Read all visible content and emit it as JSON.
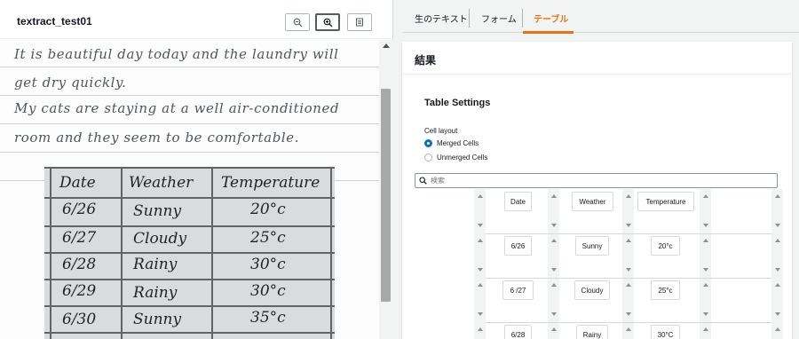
{
  "document": {
    "title": "textract_test01",
    "handwriting": [
      "It is beautiful day today and the laundry will",
      "get dry quickly.",
      "My cats are staying at a well air-conditioned",
      "room and they seem to be comfortable."
    ],
    "photo_table": {
      "headers": [
        "Date",
        "Weather",
        "Temperature"
      ],
      "rows": [
        [
          "6/26",
          "Sunny",
          "20°c"
        ],
        [
          "6/27",
          "Cloudy",
          "25°c"
        ],
        [
          "6/28",
          "Rainy",
          "30°c"
        ],
        [
          "6/29",
          "Rainy",
          "30°c"
        ],
        [
          "6/30",
          "Sunny",
          "35°c"
        ]
      ]
    }
  },
  "tabs": [
    {
      "label": "生のテキスト",
      "active": false
    },
    {
      "label": "フォーム",
      "active": false
    },
    {
      "label": "テーブル",
      "active": true
    }
  ],
  "results": {
    "title": "結果",
    "settings_title": "Table Settings",
    "cell_layout_label": "Cell layout",
    "options": [
      {
        "label": "Merged Cells",
        "selected": true
      },
      {
        "label": "Unmerged Cells",
        "selected": false
      }
    ],
    "search_placeholder": "検索",
    "table": [
      [
        "Date",
        "Weather",
        "Temperature"
      ],
      [
        "6/26",
        "Sunny",
        "20°c"
      ],
      [
        "6 /27",
        "Cloudy",
        "25°c"
      ],
      [
        "6/28",
        "Rainy",
        "30°C"
      ]
    ]
  },
  "colors": {
    "accent": "#ec7211",
    "radio_selected": "#0073bb"
  },
  "icons": [
    "zoom-out-icon",
    "zoom-in-icon",
    "fit-page-icon",
    "search-icon"
  ]
}
